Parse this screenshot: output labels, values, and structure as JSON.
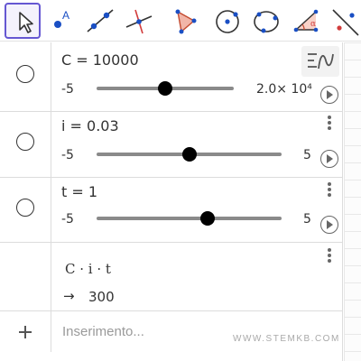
{
  "toolbar": {
    "tools": [
      {
        "name": "move-tool",
        "icon": "cursor-arrow-icon",
        "active": true
      },
      {
        "name": "point-tool",
        "icon": "point-icon"
      },
      {
        "name": "line-tool",
        "icon": "line-through-two-points-icon"
      },
      {
        "name": "perpendicular-line-tool",
        "icon": "perpendicular-line-icon"
      },
      {
        "name": "polygon-tool",
        "icon": "polygon-icon"
      },
      {
        "name": "circle-tool",
        "icon": "circle-center-point-icon"
      },
      {
        "name": "circle-three-points-tool",
        "icon": "circle-three-points-icon"
      },
      {
        "name": "angle-tool",
        "icon": "angle-icon"
      },
      {
        "name": "reflect-tool",
        "icon": "reflect-about-line-icon"
      }
    ],
    "point_label": "A",
    "angle_label": "α"
  },
  "algebra": {
    "toggle_icon": "algebra-description-toggle-icon",
    "sliders": [
      {
        "definition": "C = 10000",
        "min": "-5",
        "max": "2.0× 10⁴",
        "value": 10000,
        "position_fraction": 0.5
      },
      {
        "definition": "i = 0.03",
        "min": "-5",
        "max": "5",
        "value": 0.03,
        "position_fraction": 0.503
      },
      {
        "definition": "t = 1",
        "min": "-5",
        "max": "5",
        "value": 1,
        "position_fraction": 0.6
      }
    ],
    "expression": {
      "formula": "C · i · t",
      "arrow": "→",
      "result": "300"
    },
    "input": {
      "placeholder": "Inserimento..."
    }
  },
  "watermark": "WWW.STEMKB.COM",
  "colors": {
    "accent": "#6557d2",
    "point_blue": "#1a4fc4",
    "polygon_fill": "#f1b5a8",
    "polygon_stroke": "#c34a2f"
  }
}
